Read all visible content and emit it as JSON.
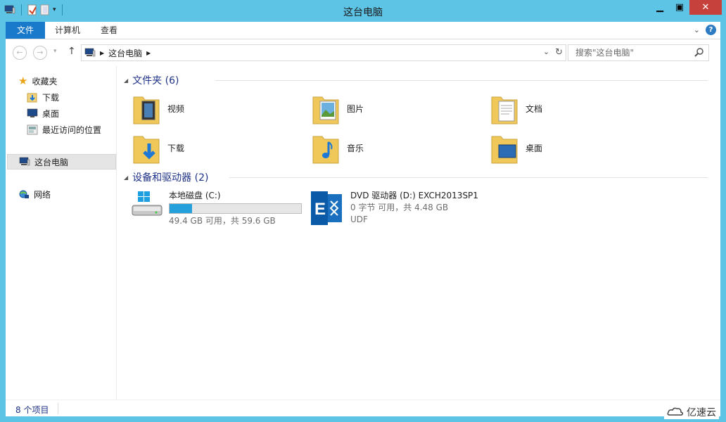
{
  "window": {
    "title": "这台电脑"
  },
  "ribbon": {
    "tabs": [
      "文件",
      "计算机",
      "查看"
    ]
  },
  "address": {
    "path": "这台电脑"
  },
  "search": {
    "placeholder": "搜索\"这台电脑\""
  },
  "sidebar": {
    "favorites": "收藏夹",
    "fav_items": [
      "下载",
      "桌面",
      "最近访问的位置"
    ],
    "this_pc": "这台电脑",
    "network": "网络"
  },
  "folders": {
    "header": "文件夹 (6)",
    "items": [
      "视频",
      "图片",
      "文档",
      "下载",
      "音乐",
      "桌面"
    ]
  },
  "devices": {
    "header": "设备和驱动器 (2)",
    "local": {
      "name": "本地磁盘 (C:)",
      "space": "49.4 GB 可用，共 59.6 GB",
      "used_fraction": 0.17
    },
    "dvd": {
      "name": "DVD 驱动器 (D:) EXCH2013SP1",
      "space": "0 字节 可用，共 4.48 GB",
      "fs": "UDF"
    }
  },
  "status": {
    "count": "8 个项目"
  },
  "watermark": {
    "text": "亿速云"
  }
}
